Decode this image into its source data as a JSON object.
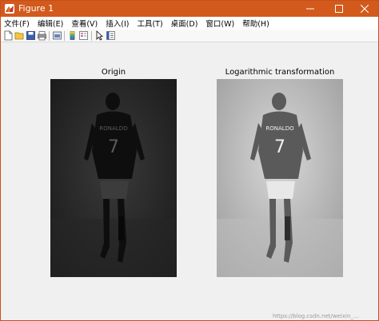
{
  "window": {
    "title": "Figure 1",
    "controls": [
      "minimize-icon",
      "maximize-icon",
      "close-icon"
    ]
  },
  "menu": {
    "items": [
      {
        "label": "文件(F)"
      },
      {
        "label": "编辑(E)"
      },
      {
        "label": "查看(V)"
      },
      {
        "label": "插入(I)"
      },
      {
        "label": "工具(T)"
      },
      {
        "label": "桌面(D)"
      },
      {
        "label": "窗口(W)"
      },
      {
        "label": "帮助(H)"
      }
    ]
  },
  "toolbar": {
    "icons": [
      "new-figure-icon",
      "open-file-icon",
      "save-icon",
      "print-icon",
      "link-plot-icon",
      "insert-colorbar-icon",
      "insert-legend-icon",
      "edit-plot-arrow-icon",
      "property-inspector-icon"
    ]
  },
  "figure": {
    "axes": [
      {
        "title": "Origin",
        "image": "grayscale-dark-footballer-photo"
      },
      {
        "title": "Logarithmic transformation",
        "image": "grayscale-brightened-footballer-photo"
      }
    ]
  },
  "player_jersey": {
    "name": "RONALDO",
    "number": "7"
  },
  "watermark": "https://blog.csdn.net/weixin_..."
}
